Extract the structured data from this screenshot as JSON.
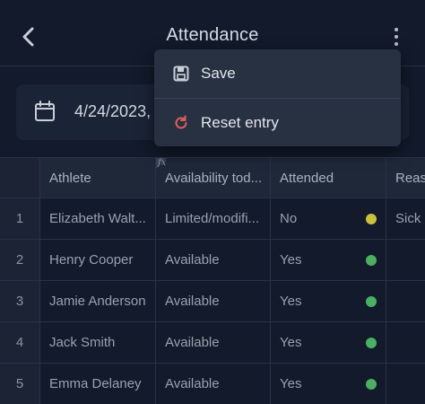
{
  "header": {
    "title": "Attendance"
  },
  "date_card": {
    "date": "4/24/2023,"
  },
  "menu": {
    "items": [
      {
        "label": "Save",
        "icon": "save-icon"
      },
      {
        "label": "Reset entry",
        "icon": "reset-icon",
        "icon_color": "#e0605a"
      }
    ]
  },
  "table": {
    "formula_marker": "fx",
    "columns": [
      "",
      "Athlete",
      "Availability tod...",
      "Attended",
      "Reas"
    ],
    "rows": [
      {
        "idx": "1",
        "athlete": "Elizabeth Walt...",
        "availability": "Limited/modifi...",
        "attended": "No",
        "status_color": "#c9c23f",
        "reason": "Sick"
      },
      {
        "idx": "2",
        "athlete": "Henry Cooper",
        "availability": "Available",
        "attended": "Yes",
        "status_color": "#4caf62",
        "reason": ""
      },
      {
        "idx": "3",
        "athlete": "Jamie Anderson",
        "availability": "Available",
        "attended": "Yes",
        "status_color": "#4caf62",
        "reason": ""
      },
      {
        "idx": "4",
        "athlete": "Jack Smith",
        "availability": "Available",
        "attended": "Yes",
        "status_color": "#4caf62",
        "reason": ""
      },
      {
        "idx": "5",
        "athlete": "Emma Delaney",
        "availability": "Available",
        "attended": "Yes",
        "status_color": "#4caf62",
        "reason": ""
      }
    ]
  }
}
